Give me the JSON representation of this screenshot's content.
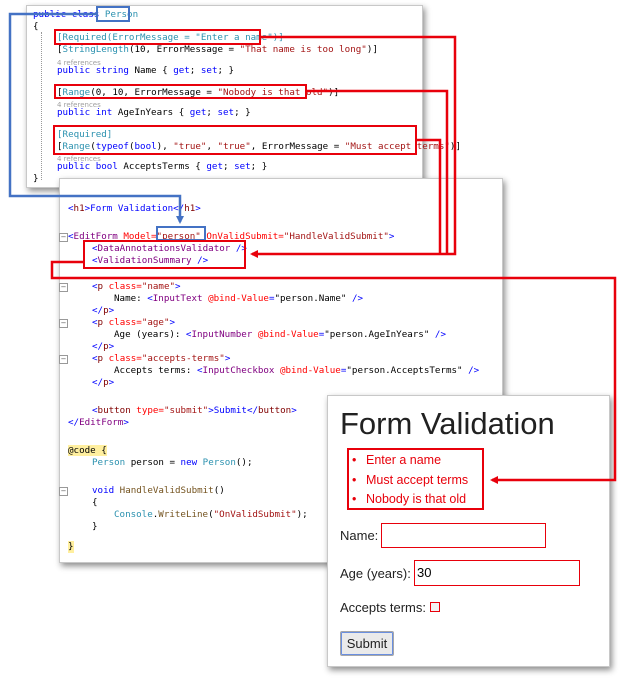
{
  "model_code": {
    "l1": [
      "public class ",
      "Person"
    ],
    "l2": "{",
    "required1": "[Required(ErrorMessage = \"Enter a name\")]",
    "strlen": [
      "[",
      "StringLength",
      "(10, ErrorMessage = ",
      "\"That name is too long\"",
      ")]"
    ],
    "refs_a": "4 references",
    "name_prop": [
      "public string ",
      "Name { ",
      "get",
      "; ",
      "set",
      "; }"
    ],
    "range1": [
      "[",
      "Range",
      "(0, 10, ErrorMessage = ",
      "\"Nobody is that old\"",
      ")]"
    ],
    "refs_b": "4 references",
    "age_prop": [
      "public int ",
      "AgeInYears { ",
      "get",
      "; ",
      "set",
      "; }"
    ],
    "required2": "[Required]",
    "range2": [
      "[",
      "Range",
      "(",
      "typeof",
      "(",
      "bool",
      "), ",
      "\"true\"",
      ", ",
      "\"true\"",
      ", ErrorMessage = ",
      "\"Must accept terms\"",
      ")]"
    ],
    "refs_c": "4 references",
    "terms_prop": [
      "public bool ",
      "AcceptsTerms { ",
      "get",
      "; ",
      "set",
      "; }"
    ],
    "end": "}"
  },
  "razor_code": {
    "h1": [
      "<",
      "h1",
      ">Form Validation</",
      "h1",
      ">"
    ],
    "editform": [
      "<",
      "EditForm",
      " Model=",
      "\"person\"",
      " OnValidSubmit=",
      "\"HandleValidSubmit\"",
      ">"
    ],
    "validator": [
      "<",
      "DataAnnotationsValidator",
      " />"
    ],
    "summary": [
      "<",
      "ValidationSummary",
      " />"
    ],
    "p_name": [
      "<",
      "p",
      " class=",
      "\"name\"",
      ">"
    ],
    "name_line": [
      "Name: ",
      "<",
      "InputText",
      " @bind-Value",
      "=",
      "\"person.Name\"",
      " />"
    ],
    "p_close1": [
      "</",
      "p",
      ">"
    ],
    "p_age": [
      "<",
      "p",
      " class=",
      "\"age\"",
      ">"
    ],
    "age_line": [
      "Age (years): ",
      "<",
      "InputNumber",
      " @bind-Value",
      "=",
      "\"person.AgeInYears\"",
      " />"
    ],
    "p_close2": [
      "</",
      "p",
      ">"
    ],
    "p_terms": [
      "<",
      "p",
      " class=",
      "\"accepts-terms\"",
      ">"
    ],
    "terms_line": [
      "Accepts terms: ",
      "<",
      "InputCheckbox",
      " @bind-Value",
      "=",
      "\"person.AcceptsTerms\"",
      " />"
    ],
    "p_close3": [
      "</",
      "p",
      ">"
    ],
    "button_line": [
      "<",
      "button",
      " type=",
      "\"submit\"",
      ">Submit</",
      "button",
      ">"
    ],
    "editform_close": [
      "</",
      "EditForm",
      ">"
    ],
    "code_open": [
      "@code",
      " {"
    ],
    "person_decl": [
      "Person",
      " person = ",
      "new ",
      "Person",
      "();"
    ],
    "method": [
      "void ",
      "HandleValidSubmit",
      "()"
    ],
    "brace_open": "{",
    "console": [
      "Console",
      ".",
      "WriteLine",
      "(",
      "\"OnValidSubmit\"",
      ");"
    ],
    "brace_close": "}",
    "code_close": "}"
  },
  "rendered_form": {
    "title": "Form Validation",
    "errors": [
      "Enter a name",
      "Must accept terms",
      "Nobody is that old"
    ],
    "name_label": "Name:",
    "name_value": "",
    "age_label": "Age (years):",
    "age_value": "30",
    "terms_label": "Accepts terms:",
    "submit_label": "Submit"
  },
  "colors": {
    "annotation_red": "#e8000b",
    "annotation_blue": "#4472c4",
    "keyword": "#0000ff",
    "type": "#2b91af",
    "string": "#a31515",
    "tag": "#800000",
    "component": "#800080"
  }
}
